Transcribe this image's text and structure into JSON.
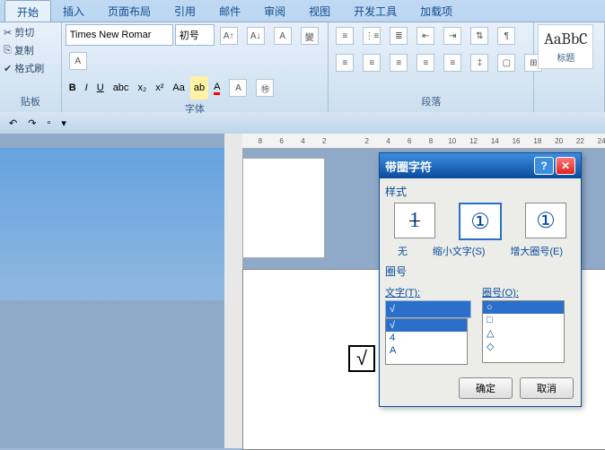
{
  "tabs": [
    "开始",
    "插入",
    "页面布局",
    "引用",
    "邮件",
    "审阅",
    "视图",
    "开发工具",
    "加载项"
  ],
  "clipboard": {
    "cut": "剪切",
    "copy": "复制",
    "fmt": "格式刷",
    "label": "贴板"
  },
  "font": {
    "name": "Times New Romar",
    "size": "初号",
    "label": "字体",
    "bold": "B",
    "italic": "I",
    "underline": "U"
  },
  "para": {
    "label": "段落"
  },
  "styles": {
    "preview": "AaBbC",
    "name": "标题"
  },
  "ruler": [
    "8",
    "6",
    "4",
    "2",
    "",
    "2",
    "4",
    "6",
    "8",
    "10",
    "12",
    "14",
    "16",
    "18",
    "20",
    "22",
    "24"
  ],
  "dialog": {
    "title": "带圈字符",
    "style_label": "样式",
    "none": "无",
    "shrink": "缩小文字(S)",
    "enlarge": "增大圈号(E)",
    "circ_label": "圈号",
    "text_lbl": "文字(T):",
    "circ_lbl": "圈号(O):",
    "text_items": [
      "√",
      "√",
      "4",
      "A"
    ],
    "circ_items": [
      "○",
      "□",
      "△",
      "◇"
    ],
    "ok": "确定",
    "cancel": "取消"
  },
  "doc_symbol": "√"
}
